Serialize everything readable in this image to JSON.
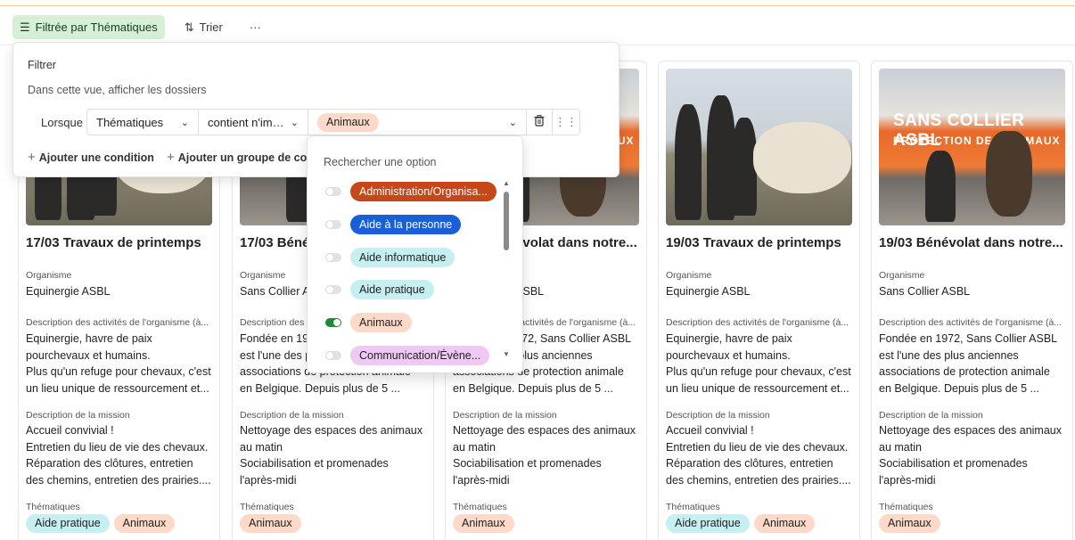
{
  "toolbar": {
    "filter_label": "Filtrée par Thématiques",
    "sort_label": "Trier",
    "more_label": "···"
  },
  "popover": {
    "title": "Filtrer",
    "subtitle": "Dans cette vue, afficher les dossiers",
    "when": "Lorsque",
    "field": "Thématiques",
    "operator": "contient n'im…",
    "value_tag": "Animaux",
    "add_condition": "Ajouter une condition",
    "add_group": "Ajouter un groupe de co"
  },
  "dropdown": {
    "search_placeholder": "Rechercher une option",
    "options": [
      {
        "label": "Administration/Organisa...",
        "checked": false,
        "color": "#c7461a",
        "text_color": "#ffffff"
      },
      {
        "label": "Aide à la personne",
        "checked": false,
        "color": "#1a5fd8",
        "text_color": "#ffffff"
      },
      {
        "label": "Aide informatique",
        "checked": false,
        "color": "#c6eff2",
        "text_color": "#222222"
      },
      {
        "label": "Aide pratique",
        "checked": false,
        "color": "#c6eff2",
        "text_color": "#222222"
      },
      {
        "label": "Animaux",
        "checked": true,
        "color": "#fcd9c8",
        "text_color": "#222222"
      },
      {
        "label": "Communication/Évène...",
        "checked": false,
        "color": "#efc8f4",
        "text_color": "#222222"
      }
    ]
  },
  "labels": {
    "organisme": "Organisme",
    "description_org": "Description des activités de l'organisme (à...",
    "description_mission": "Description de la mission",
    "thematiques": "Thématiques"
  },
  "cards": [
    {
      "title": "17/03 Travaux de printemps",
      "org": "Equinergie ASBL",
      "desc_org": [
        "Equinergie, havre de paix",
        "pourchevaux et humains.",
        "Plus qu'un refuge pour chevaux, c'est",
        "un lieu unique de ressourcement et..."
      ],
      "desc_mission": [
        "Accueil convivial !",
        "Entretien du lieu de vie des chevaux.",
        "Réparation des clôtures, entretien",
        "des chemins, entretien des prairies...."
      ],
      "tags": [
        "Aide pratique",
        "Animaux"
      ]
    },
    {
      "title": "17/03 Bénévolat dans notre...",
      "org": "Sans Collier ASBL",
      "desc_org": [
        "Fondée en 1972, Sans Collier ASBL",
        "est l'une des plus anciennes",
        "associations de protection animale",
        "en Belgique. Depuis plus de 5 ..."
      ],
      "desc_mission": [
        "Nettoyage des espaces des animaux",
        "au matin",
        "Sociabilisation et promenades",
        "l'après-midi"
      ],
      "tags": [
        "Animaux"
      ]
    },
    {
      "title": "18/03 Bénévolat dans notre...",
      "org": "Sans Collier ASBL",
      "desc_org": [
        "Fondée en 1972, Sans Collier ASBL",
        "est l'une des plus anciennes",
        "associations de protection animale",
        "en Belgique. Depuis plus de 5 ..."
      ],
      "desc_mission": [
        "Nettoyage des espaces des animaux",
        "au matin",
        "Sociabilisation et promenades",
        "l'après-midi"
      ],
      "tags": [
        "Animaux"
      ]
    },
    {
      "title": "19/03 Travaux de printemps",
      "org": "Equinergie ASBL",
      "desc_org": [
        "Equinergie, havre de paix",
        "pourchevaux et humains.",
        "Plus qu'un refuge pour chevaux, c'est",
        "un lieu unique de ressourcement et..."
      ],
      "desc_mission": [
        "Accueil convivial !",
        "Entretien du lieu de vie des chevaux.",
        "Réparation des clôtures, entretien",
        "des chemins, entretien des prairies...."
      ],
      "tags": [
        "Aide pratique",
        "Animaux"
      ]
    },
    {
      "title": "19/03 Bénévolat dans notre...",
      "org": "Sans Collier ASBL",
      "desc_org": [
        "Fondée en 1972, Sans Collier ASBL",
        "est l'une des plus anciennes",
        "associations de protection animale",
        "en Belgique. Depuis plus de 5 ..."
      ],
      "desc_mission": [
        "Nettoyage des espaces des animaux",
        "au matin",
        "Sociabilisation et promenades",
        "l'après-midi"
      ],
      "tags": [
        "Animaux"
      ]
    }
  ],
  "sans_collier_banner": {
    "line1": "SANS COLLIER ASBL",
    "line2": "PROTECTION DES ANIMAUX"
  }
}
